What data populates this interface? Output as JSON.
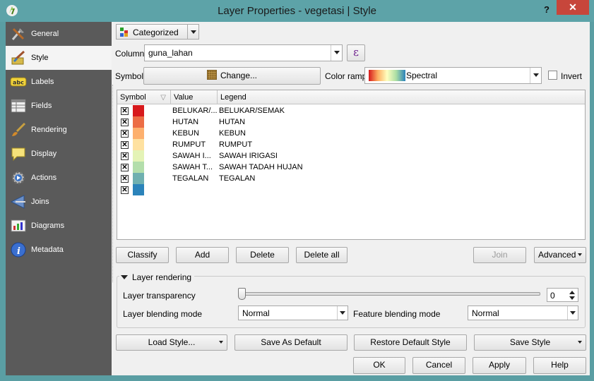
{
  "window": {
    "title": "Layer Properties - vegetasi | Style",
    "help_label": "?",
    "close_label": "✕"
  },
  "sidebar": {
    "items": [
      {
        "label": "General",
        "icon": "tools-icon",
        "active": false
      },
      {
        "label": "Style",
        "icon": "paint-brush-icon",
        "active": true
      },
      {
        "label": "Labels",
        "icon": "labels-icon",
        "active": false
      },
      {
        "label": "Fields",
        "icon": "fields-table-icon",
        "active": false
      },
      {
        "label": "Rendering",
        "icon": "rendering-brush-icon",
        "active": false
      },
      {
        "label": "Display",
        "icon": "speech-bubble-icon",
        "active": false
      },
      {
        "label": "Actions",
        "icon": "gear-icon",
        "active": false
      },
      {
        "label": "Joins",
        "icon": "joins-icon",
        "active": false
      },
      {
        "label": "Diagrams",
        "icon": "diagrams-icon",
        "active": false
      },
      {
        "label": "Metadata",
        "icon": "info-icon",
        "active": false
      }
    ]
  },
  "style": {
    "renderer": "Categorized",
    "column_label": "Column",
    "column_value": "guna_lahan",
    "expression_label": "ε",
    "symbol_label": "Symbol",
    "change_label": "Change...",
    "color_ramp_label": "Color ramp",
    "color_ramp_value": "Spectral",
    "invert_label": "Invert",
    "invert_checked": false
  },
  "table": {
    "headers": {
      "symbol": "Symbol",
      "value": "Value",
      "legend": "Legend"
    },
    "rows": [
      {
        "checked": true,
        "color": "#d7191c",
        "value": "BELUKAR/...",
        "legend": "BELUKAR/SEMAK"
      },
      {
        "checked": true,
        "color": "#ec6d45",
        "value": "HUTAN",
        "legend": "HUTAN"
      },
      {
        "checked": true,
        "color": "#fdb06e",
        "value": "KEBUN",
        "legend": "KEBUN"
      },
      {
        "checked": true,
        "color": "#fee1a0",
        "value": "RUMPUT",
        "legend": "RUMPUT"
      },
      {
        "checked": true,
        "color": "#e4f3b6",
        "value": "SAWAH I...",
        "legend": "SAWAH IRIGASI"
      },
      {
        "checked": true,
        "color": "#b3deab",
        "value": "SAWAH T...",
        "legend": "SAWAH TADAH HUJAN"
      },
      {
        "checked": true,
        "color": "#6fb0b0",
        "value": "TEGALAN",
        "legend": "TEGALAN"
      },
      {
        "checked": true,
        "color": "#2b83ba",
        "value": "",
        "legend": ""
      }
    ]
  },
  "buttons": {
    "classify": "Classify",
    "add": "Add",
    "delete": "Delete",
    "delete_all": "Delete all",
    "join": "Join",
    "advanced": "Advanced",
    "load_style": "Load Style...",
    "save_default": "Save As Default",
    "restore_default": "Restore Default Style",
    "save_style": "Save Style",
    "ok": "OK",
    "cancel": "Cancel",
    "apply": "Apply",
    "help": "Help"
  },
  "rendering": {
    "group_title": "Layer rendering",
    "transparency_label": "Layer transparency",
    "transparency_value": "0",
    "blending_label": "Layer blending mode",
    "blending_value": "Normal",
    "feature_blending_label": "Feature blending mode",
    "feature_blending_value": "Normal"
  }
}
